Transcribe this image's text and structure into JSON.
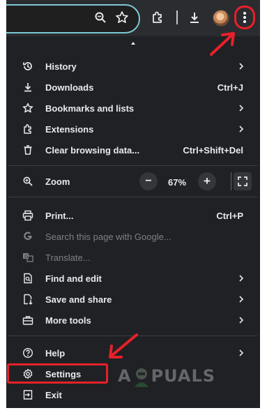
{
  "toolbar": {
    "icons": [
      "zoom-icon",
      "bookmark-star-icon",
      "extensions-icon",
      "download-icon",
      "profile-avatar",
      "more-vert-icon"
    ]
  },
  "menu": {
    "items": [
      {
        "label": "History",
        "icon": "history-icon",
        "shortcut": "",
        "submenu": true
      },
      {
        "label": "Downloads",
        "icon": "download-icon",
        "shortcut": "Ctrl+J",
        "submenu": false
      },
      {
        "label": "Bookmarks and lists",
        "icon": "star-icon",
        "shortcut": "",
        "submenu": true
      },
      {
        "label": "Extensions",
        "icon": "puzzle-icon",
        "shortcut": "",
        "submenu": true
      },
      {
        "label": "Clear browsing data...",
        "icon": "trash-icon",
        "shortcut": "Ctrl+Shift+Del",
        "submenu": false
      }
    ],
    "zoom": {
      "label": "Zoom",
      "value": "67%",
      "minus": "−",
      "plus": "+"
    },
    "items2": [
      {
        "label": "Print...",
        "icon": "print-icon",
        "shortcut": "Ctrl+P",
        "submenu": false,
        "disabled": false
      },
      {
        "label": "Search this page with Google...",
        "icon": "google-icon",
        "shortcut": "",
        "submenu": false,
        "disabled": true
      },
      {
        "label": "Translate...",
        "icon": "translate-icon",
        "shortcut": "",
        "submenu": false,
        "disabled": true
      },
      {
        "label": "Find and edit",
        "icon": "find-icon",
        "shortcut": "",
        "submenu": true,
        "disabled": false
      },
      {
        "label": "Save and share",
        "icon": "save-share-icon",
        "shortcut": "",
        "submenu": true,
        "disabled": false
      },
      {
        "label": "More tools",
        "icon": "toolbox-icon",
        "shortcut": "",
        "submenu": true,
        "disabled": false
      }
    ],
    "items3": [
      {
        "label": "Help",
        "icon": "help-icon",
        "shortcut": "",
        "submenu": true
      },
      {
        "label": "Settings",
        "icon": "gear-icon",
        "shortcut": "",
        "submenu": false
      },
      {
        "label": "Exit",
        "icon": "exit-icon",
        "shortcut": "",
        "submenu": false
      }
    ]
  },
  "highlight_color": "#e8202a",
  "watermark": {
    "before": "A",
    "after": "PUALS"
  }
}
